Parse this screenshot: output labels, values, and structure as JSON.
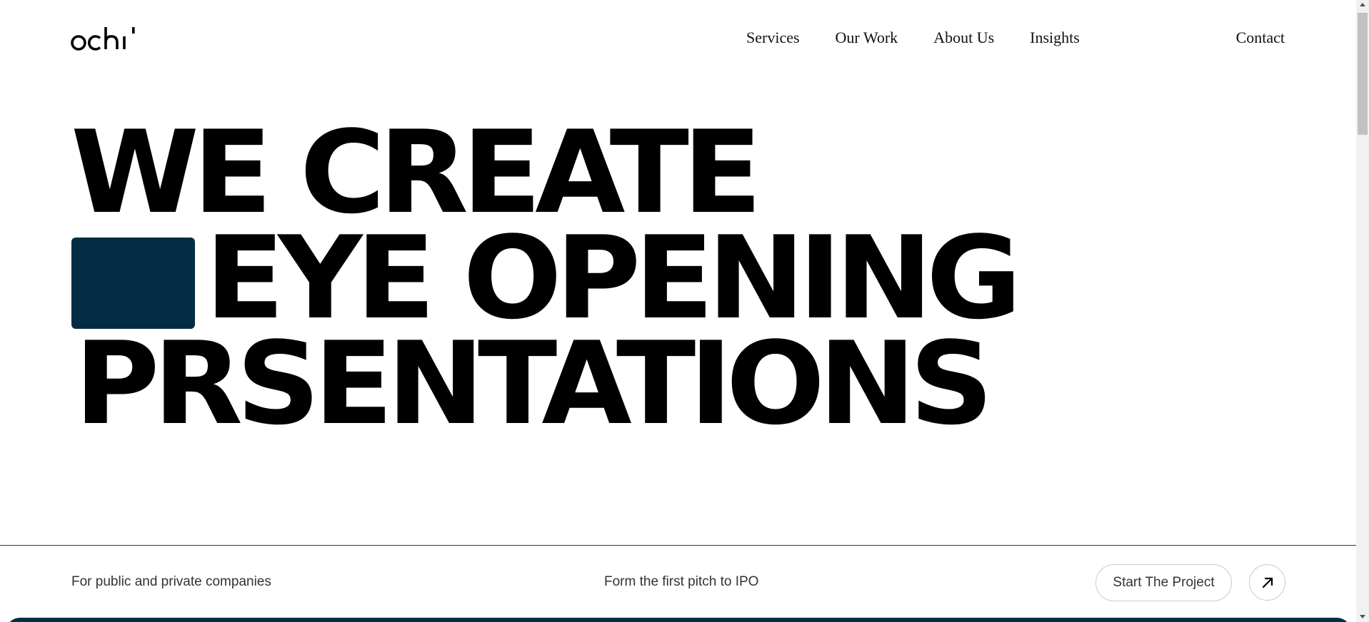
{
  "brand": {
    "logo_text": "ochi"
  },
  "nav": {
    "items": [
      {
        "label": "Services"
      },
      {
        "label": "Our Work"
      },
      {
        "label": "About Us"
      },
      {
        "label": "Insights"
      }
    ],
    "contact_label": "Contact"
  },
  "hero": {
    "line1": "WE CREATE",
    "line2": "EYE OPENING",
    "line3": "PRSENTATIONS",
    "accent_color": "#022d43"
  },
  "info": {
    "left_text": "For public and private companies",
    "middle_text": "Form the first pitch to IPO",
    "cta_label": "Start The Project",
    "cta_icon": "arrow-up-right-icon"
  }
}
